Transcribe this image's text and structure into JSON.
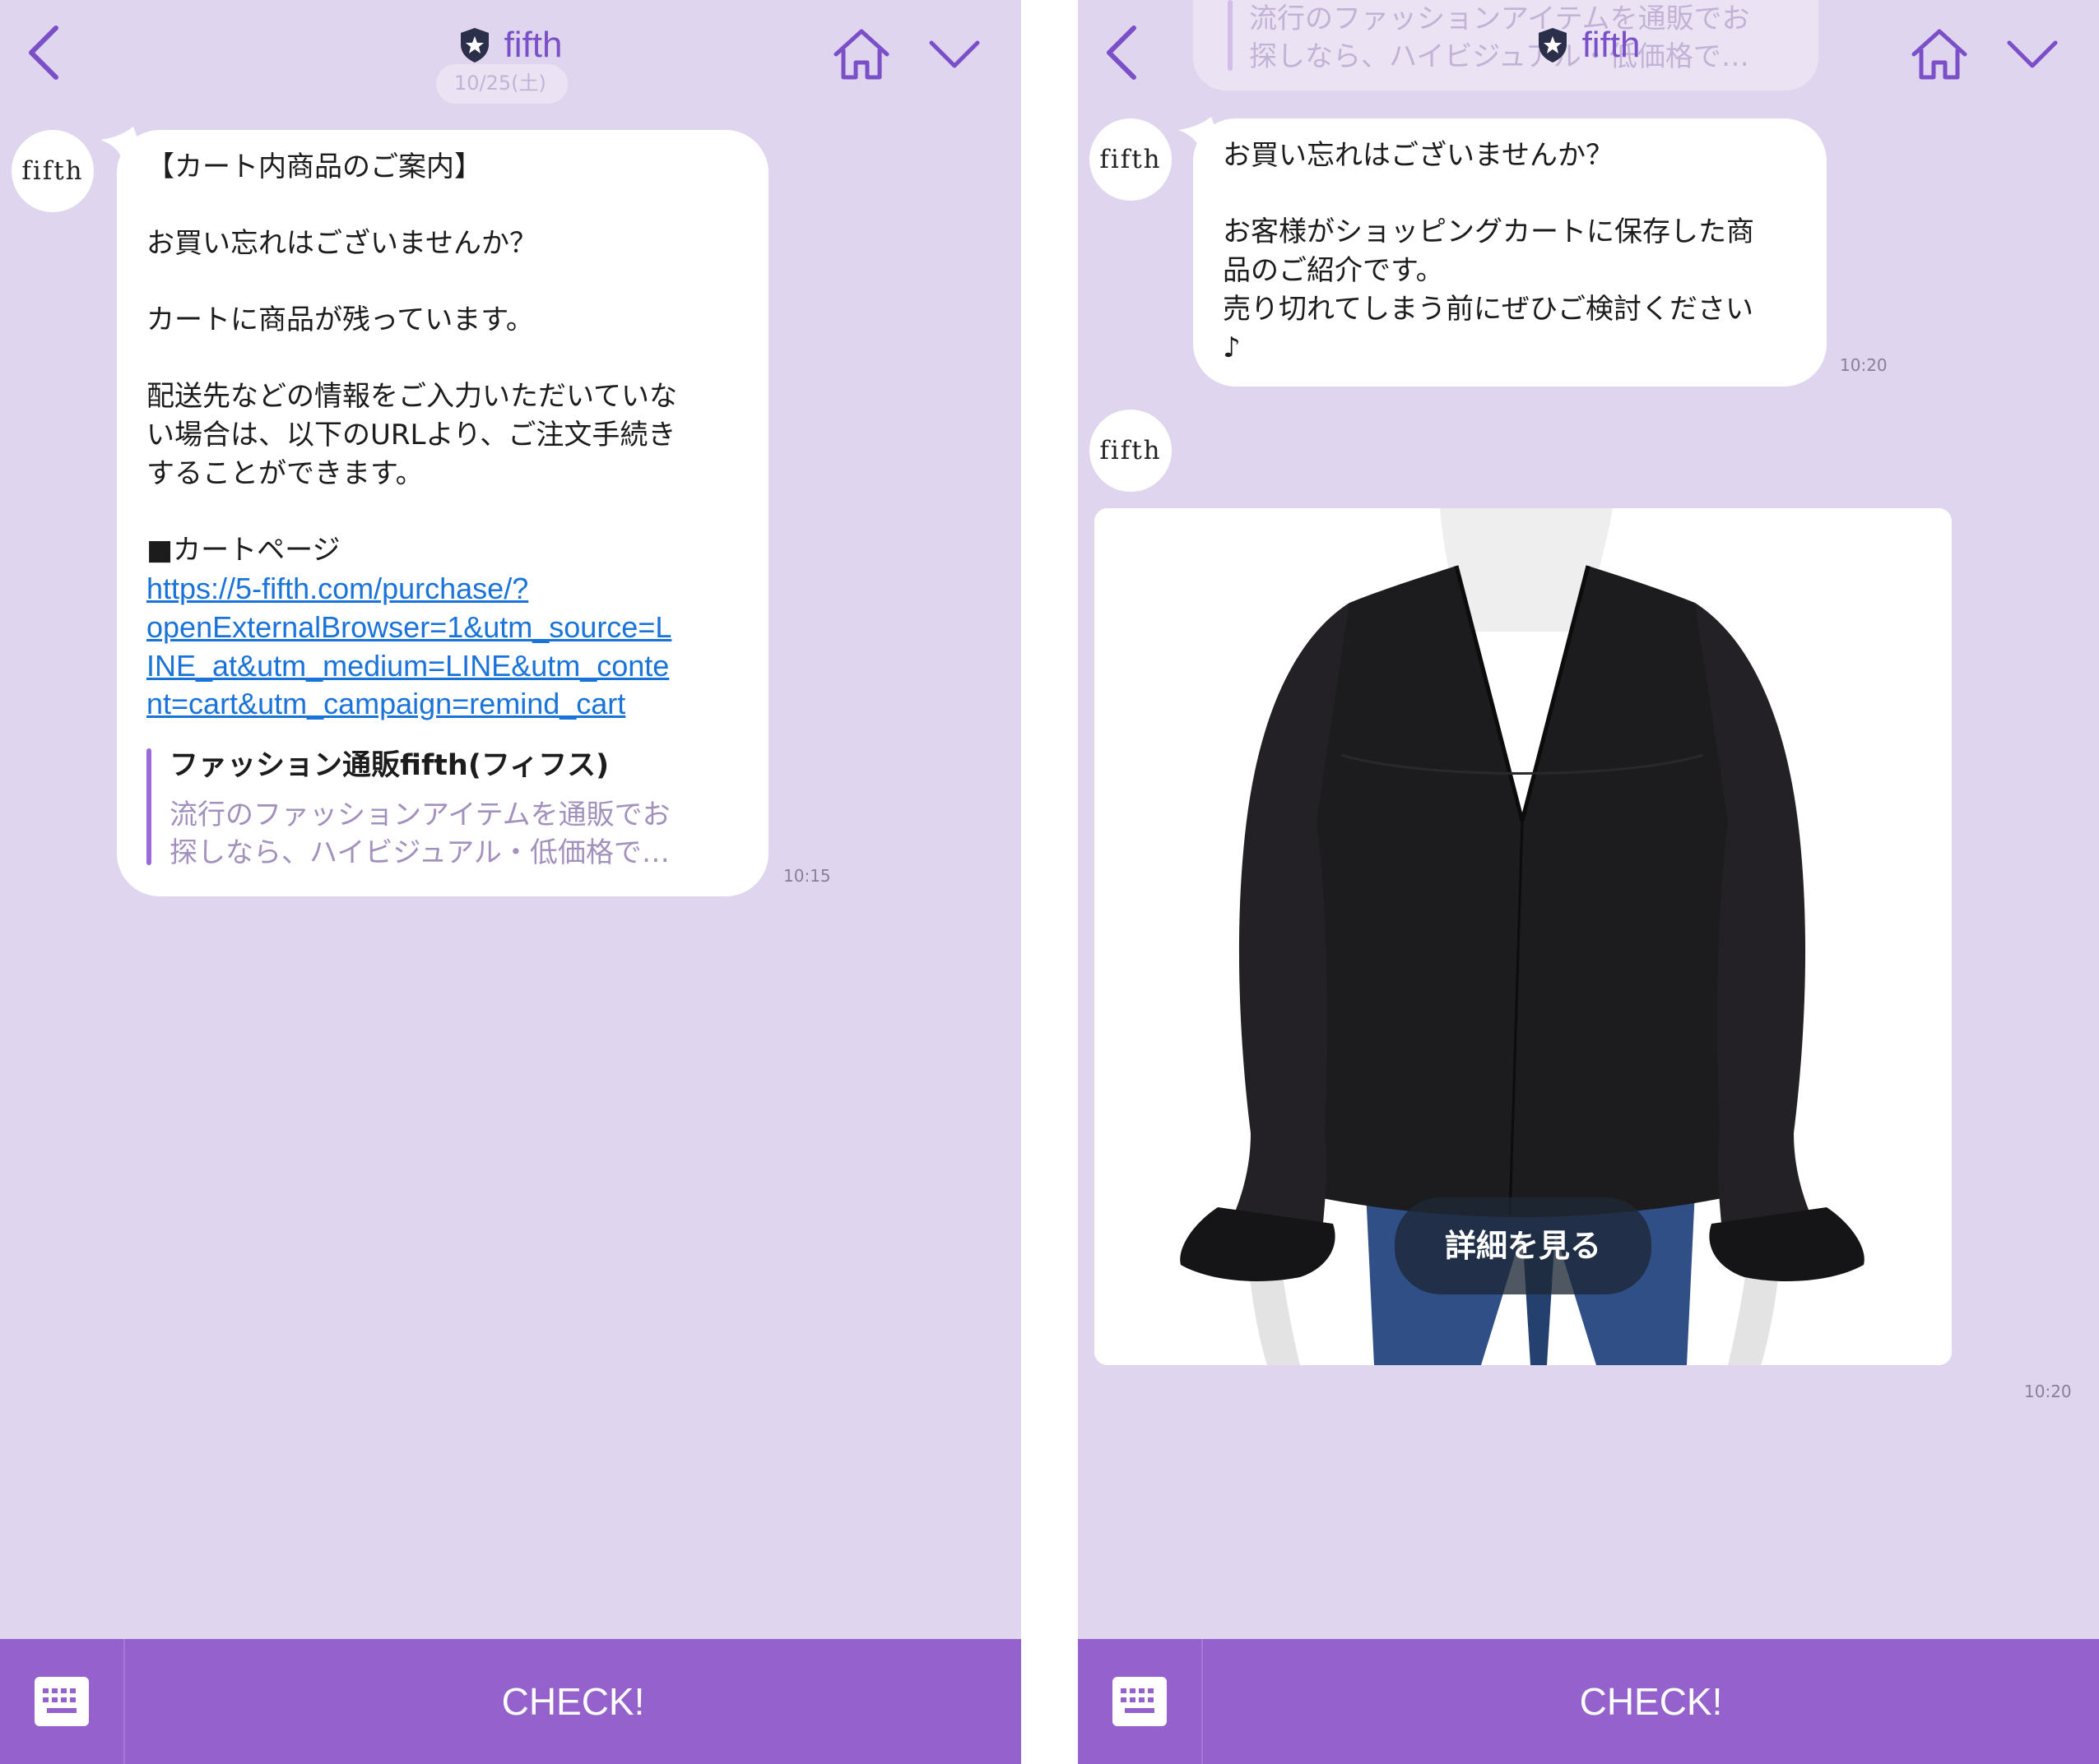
{
  "left": {
    "header": {
      "title": "fifth"
    },
    "ghost_label": "10/25(土)",
    "message": {
      "lines": [
        "【カート内商品のご案内】",
        "お買い忘れはございませんか？",
        "カートに商品が残っています。",
        "配送先などの情報をご入力いただいていな",
        "い場合は、以下のURLより、ご注文手続き",
        "することができます。",
        "■カートページ"
      ],
      "link_lines": [
        "https://5-fifth.com/purchase/?",
        "openExternalBrowser=1&utm_source=L",
        "INE_at&utm_medium=LINE&utm_conte",
        "nt=cart&utm_campaign=remind_cart"
      ],
      "preview_title": "ファッション通販fifth(フィフス)",
      "preview_desc": [
        "流行のファッションアイテムを通販でお",
        "探しなら、ハイビジュアル・低価格で…"
      ],
      "time": "10:15"
    },
    "avatar_text": "fifth",
    "bottom": {
      "button": "CHECK!"
    }
  },
  "right": {
    "header": {
      "title": "fifth"
    },
    "ghost_lines": [
      "流行のファッションアイテムを通販でお",
      "探しなら、ハイビジュアル・低価格で…"
    ],
    "message": {
      "lines": [
        "お買い忘れはございませんか？",
        "お客様がショッピングカートに保存した商",
        "品のご紹介です。",
        "売り切れてしまう前にぜひご検討ください",
        "♪"
      ],
      "time": "10:20"
    },
    "avatar_text": "fifth",
    "product": {
      "button": "詳細を見る",
      "time": "10:20"
    },
    "bottom": {
      "button": "CHECK!"
    }
  },
  "colors": {
    "background": "#e0d5ee",
    "accent": "#7a4fc7",
    "bottom_bar": "#9561cc",
    "link": "#1a73d9",
    "preview_bar": "#9b6ad6"
  },
  "icons": [
    "back-chevron-icon",
    "shield-star-icon",
    "home-icon",
    "chevron-down-icon",
    "keyboard-icon"
  ]
}
